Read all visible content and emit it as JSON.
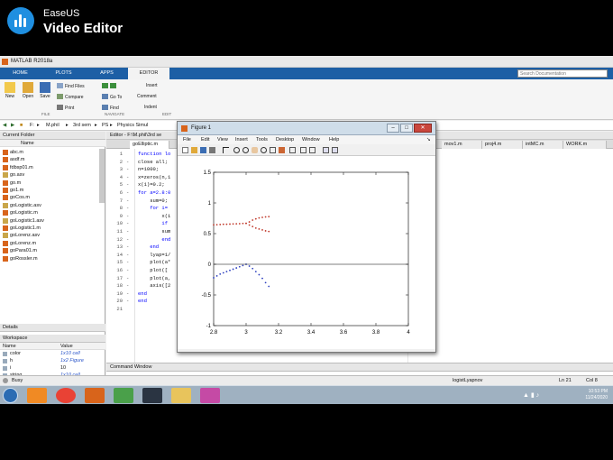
{
  "watermark": {
    "brand": "EaseUS",
    "product": "Video Editor"
  },
  "window": {
    "title": "MATLAB R2018a",
    "accent": "#1d5fa5"
  },
  "tabs": [
    {
      "label": "HOME",
      "active": false
    },
    {
      "label": "PLOTS",
      "active": false
    },
    {
      "label": "APPS",
      "active": false
    },
    {
      "label": "EDITOR",
      "active": true
    }
  ],
  "search": {
    "placeholder": "Search Documentation"
  },
  "ribbon": {
    "new": "New",
    "open": "Open",
    "save": "Save",
    "find_files": "Find Files",
    "compare": "Compare",
    "print": "Print",
    "go_to": "Go To",
    "find": "Find",
    "insert": "Insert",
    "comment": "Comment",
    "indent": "Indent",
    "sec_file": "FILE",
    "sec_navigate": "NAVIGATE",
    "sec_edit": "EDIT"
  },
  "address": [
    "F:",
    "M.phil",
    "3rd sem",
    "PS",
    "Physics Simul"
  ],
  "current_folder": {
    "title": "Current Folder",
    "column": "Name",
    "files": [
      "abc.m",
      "asdf.m",
      "fdbsp01.m",
      "go.asv",
      "go.m",
      "go1.m",
      "goCos.m",
      "goLogistic.asv",
      "goLogistic.m",
      "goLogistic1.asv",
      "goLogistic1.m",
      "goLorenz.asv",
      "goLorenz.m",
      "goPara01.m",
      "goRossler.m"
    ]
  },
  "details": {
    "title": "Details"
  },
  "workspace": {
    "title": "Workspace",
    "col_name": "Name",
    "col_value": "Value",
    "rows": [
      {
        "name": "color",
        "value": "1x10 cell"
      },
      {
        "name": "h",
        "value": "1x2 Figure"
      },
      {
        "name": "i",
        "value": "10"
      },
      {
        "name": "string",
        "value": "1x10 cell"
      }
    ]
  },
  "editor": {
    "header": "Editor - F:\\M.phil\\3rd se",
    "tabs": [
      "goElliptic.m",
      "mov1.m",
      "proj4.m",
      "intMC.m",
      "WORK.m"
    ],
    "line_numbers": [
      "1",
      "2",
      "3",
      "4",
      "5",
      "6",
      "7",
      "8",
      "9",
      "10",
      "11",
      "12",
      "13",
      "14",
      "15",
      "16",
      "17",
      "18",
      "19",
      "20",
      "21"
    ],
    "dashes": [
      "",
      "-",
      "-",
      "-",
      "-",
      "-",
      "-",
      "-",
      "-",
      "-",
      "-",
      "-",
      "-",
      "-",
      "-",
      "-",
      "-",
      "-",
      "-",
      "-",
      ""
    ],
    "lines": [
      "function lo",
      "close all;",
      "n=1000;",
      "x=zeros(n,1",
      "x(1)=0.2;",
      "for a=2.8:0",
      "    sum=0;",
      "    for i=",
      "        x(i",
      "        if",
      "        sum",
      "        end",
      "    end",
      "    lyap=1/",
      "    plot(a*",
      "    plot([",
      "    plot(a,",
      "    axis([2",
      "end",
      "end",
      ""
    ]
  },
  "command_window": {
    "title": "Command Window"
  },
  "status": {
    "state": "Busy",
    "function": "logistLyapnov",
    "ln": "Ln  21",
    "col": "Col  8"
  },
  "figure": {
    "title": "Figure 1",
    "menu": [
      "File",
      "Edit",
      "View",
      "Insert",
      "Tools",
      "Desktop",
      "Window",
      "Help"
    ]
  },
  "chart_data": {
    "type": "line",
    "xlim": [
      2.8,
      4
    ],
    "ylim": [
      -1,
      1.5
    ],
    "xticks": [
      "2.8",
      "3",
      "3.2",
      "3.4",
      "3.6",
      "3.8",
      "4"
    ],
    "yticks": [
      "-1",
      "-0.5",
      "0",
      "0.5",
      "1",
      "1.5"
    ],
    "grid": false,
    "series": [
      {
        "color": "#c0392b",
        "style": "dots",
        "x": [
          2.8,
          2.82,
          2.84,
          2.86,
          2.88,
          2.9,
          2.92,
          2.94,
          2.96,
          2.98,
          3.0,
          3.02,
          3.04,
          3.06,
          3.08,
          3.1,
          3.12,
          3.14
        ],
        "y": [
          0.643,
          0.645,
          0.648,
          0.652,
          0.653,
          0.655,
          0.658,
          0.66,
          0.662,
          0.665,
          0.667,
          0.69,
          0.72,
          0.74,
          0.755,
          0.765,
          0.772,
          0.777
        ]
      },
      {
        "color": "#c0392b",
        "style": "dots",
        "x": [
          3.0,
          3.02,
          3.04,
          3.06,
          3.08,
          3.1,
          3.12,
          3.14
        ],
        "y": [
          0.667,
          0.64,
          0.615,
          0.59,
          0.575,
          0.56,
          0.545,
          0.535
        ]
      },
      {
        "color": "#2c3fbf",
        "style": "dots",
        "x": [
          2.8,
          2.82,
          2.84,
          2.86,
          2.88,
          2.9,
          2.92,
          2.94,
          2.96,
          2.98,
          3.0,
          3.02,
          3.04,
          3.06,
          3.08,
          3.1,
          3.12,
          3.14
        ],
        "y": [
          -0.22,
          -0.19,
          -0.16,
          -0.14,
          -0.12,
          -0.1,
          -0.08,
          -0.06,
          -0.04,
          -0.02,
          0.0,
          -0.03,
          -0.07,
          -0.12,
          -0.17,
          -0.23,
          -0.3,
          -0.36
        ]
      },
      {
        "color": "#000000",
        "style": "line",
        "x": [
          2.8,
          4.0
        ],
        "y": [
          0,
          0
        ]
      }
    ]
  },
  "taskbar": {
    "time": "10:53 PM",
    "date": "11/24/2020"
  }
}
